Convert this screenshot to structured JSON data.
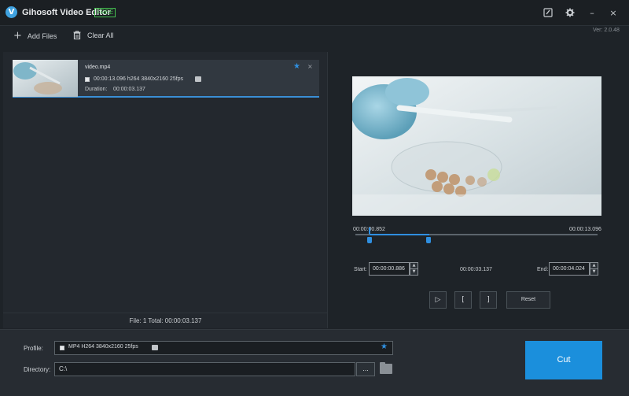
{
  "app": {
    "logo_letter": "V",
    "title": "Gihosoft Video Editor",
    "badge": "FREE",
    "version": "Ver: 2.0.48"
  },
  "window_controls": {
    "feedback_icon": "edit-note-icon",
    "settings_icon": "gear-icon",
    "minimize": "–",
    "close": "×"
  },
  "toolbar": {
    "add_files_icon": "+",
    "add_files_label": "Add Files",
    "clear_all_icon": "🗑",
    "clear_all_label": "Clear All"
  },
  "file_list": {
    "items": [
      {
        "name": "video.mp4",
        "info": "00:00:13.096 h264 3840x2160 25fps",
        "duration_label": "Duration:",
        "duration": "00:00:03.137",
        "star": "★",
        "close": "×"
      }
    ],
    "summary": "File: 1  Total: 00:00:03.137"
  },
  "player": {
    "current_time": "00:00:00.852",
    "total_time": "00:00:13.096",
    "start_label": "Start:",
    "start_value": "00:00:00.886",
    "clip_duration": "00:00:03.137",
    "end_label": "End:",
    "end_value": "00:00:04.024",
    "spin_up": "▲",
    "spin_down": "▼",
    "play_icon": "▷",
    "mark_in_icon": "[",
    "mark_out_icon": "]",
    "reset_label": "Reset"
  },
  "output": {
    "profile_label": "Profile:",
    "profile_value": "MP4 H264 3840x2160 25fps",
    "profile_star": "★",
    "directory_label": "Directory:",
    "directory_value": "C:\\",
    "browse_label": "...",
    "cut_label": "Cut"
  },
  "colors": {
    "accent": "#2f8fe0",
    "cut_button": "#1b8fdc",
    "free_badge": "#45c050"
  }
}
